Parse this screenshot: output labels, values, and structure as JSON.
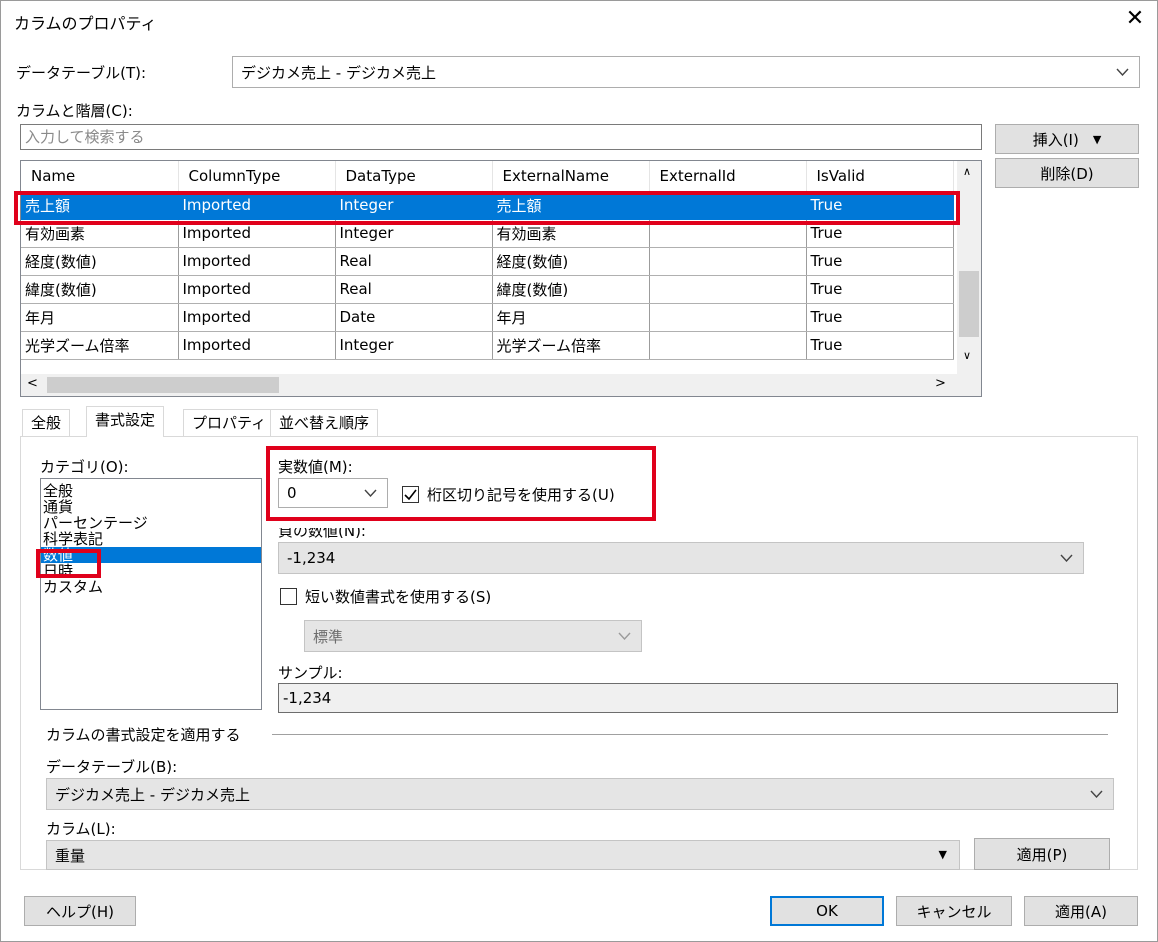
{
  "window": {
    "title": "カラムのプロパティ",
    "close": "✕"
  },
  "datatable": {
    "label": "データテーブル(T):",
    "value": "デジカメ売上 - デジカメ売上"
  },
  "columns_section": {
    "label": "カラムと階層(C):",
    "search_placeholder": "入力して検索する",
    "insert_label": "挿入(I)",
    "delete_label": "削除(D)"
  },
  "grid": {
    "headers": [
      "Name",
      "ColumnType",
      "DataType",
      "ExternalName",
      "ExternalId",
      "IsValid"
    ],
    "rows": [
      [
        "売上額",
        "Imported",
        "Integer",
        "売上額",
        "",
        "True"
      ],
      [
        "有効画素",
        "Imported",
        "Integer",
        "有効画素",
        "",
        "True"
      ],
      [
        "経度(数値)",
        "Imported",
        "Real",
        "経度(数値)",
        "",
        "True"
      ],
      [
        "緯度(数値)",
        "Imported",
        "Real",
        "緯度(数値)",
        "",
        "True"
      ],
      [
        "年月",
        "Imported",
        "Date",
        "年月",
        "",
        "True"
      ],
      [
        "光学ズーム倍率",
        "Imported",
        "Integer",
        "光学ズーム倍率",
        "",
        "True"
      ]
    ],
    "selected_row": 0
  },
  "tabs": [
    {
      "label": "全般"
    },
    {
      "label": "書式設定",
      "active": true
    },
    {
      "label": "プロパティ"
    },
    {
      "label": "並べ替え順序"
    }
  ],
  "format": {
    "category_label": "カテゴリ(O):",
    "categories": [
      "全般",
      "通貨",
      "パーセンテージ",
      "科学表記",
      "数値",
      "日時",
      "カスタム"
    ],
    "selected_category": 4,
    "decimals_label": "実数値(M):",
    "decimals_value": "0",
    "use_separator_label": "桁区切り記号を使用する(U)",
    "use_separator_checked": true,
    "negative_label": "負の数値(N):",
    "negative_value": "-1,234",
    "short_format_label": "短い数値書式を使用する(S)",
    "short_format_checked": false,
    "short_format_value": "標準",
    "sample_label": "サンプル:",
    "sample_value": "-1,234"
  },
  "apply_section": {
    "heading": "カラムの書式設定を適用する",
    "datatable_label": "データテーブル(B):",
    "datatable_value": "デジカメ売上 - デジカメ売上",
    "column_label": "カラム(L):",
    "column_value": "重量",
    "apply_button": "適用(P)"
  },
  "footer": {
    "help": "ヘルプ(H)",
    "ok": "OK",
    "cancel": "キャンセル",
    "apply": "適用(A)"
  },
  "colors": {
    "selection": "#0078d7",
    "highlight": "#e0001b"
  }
}
